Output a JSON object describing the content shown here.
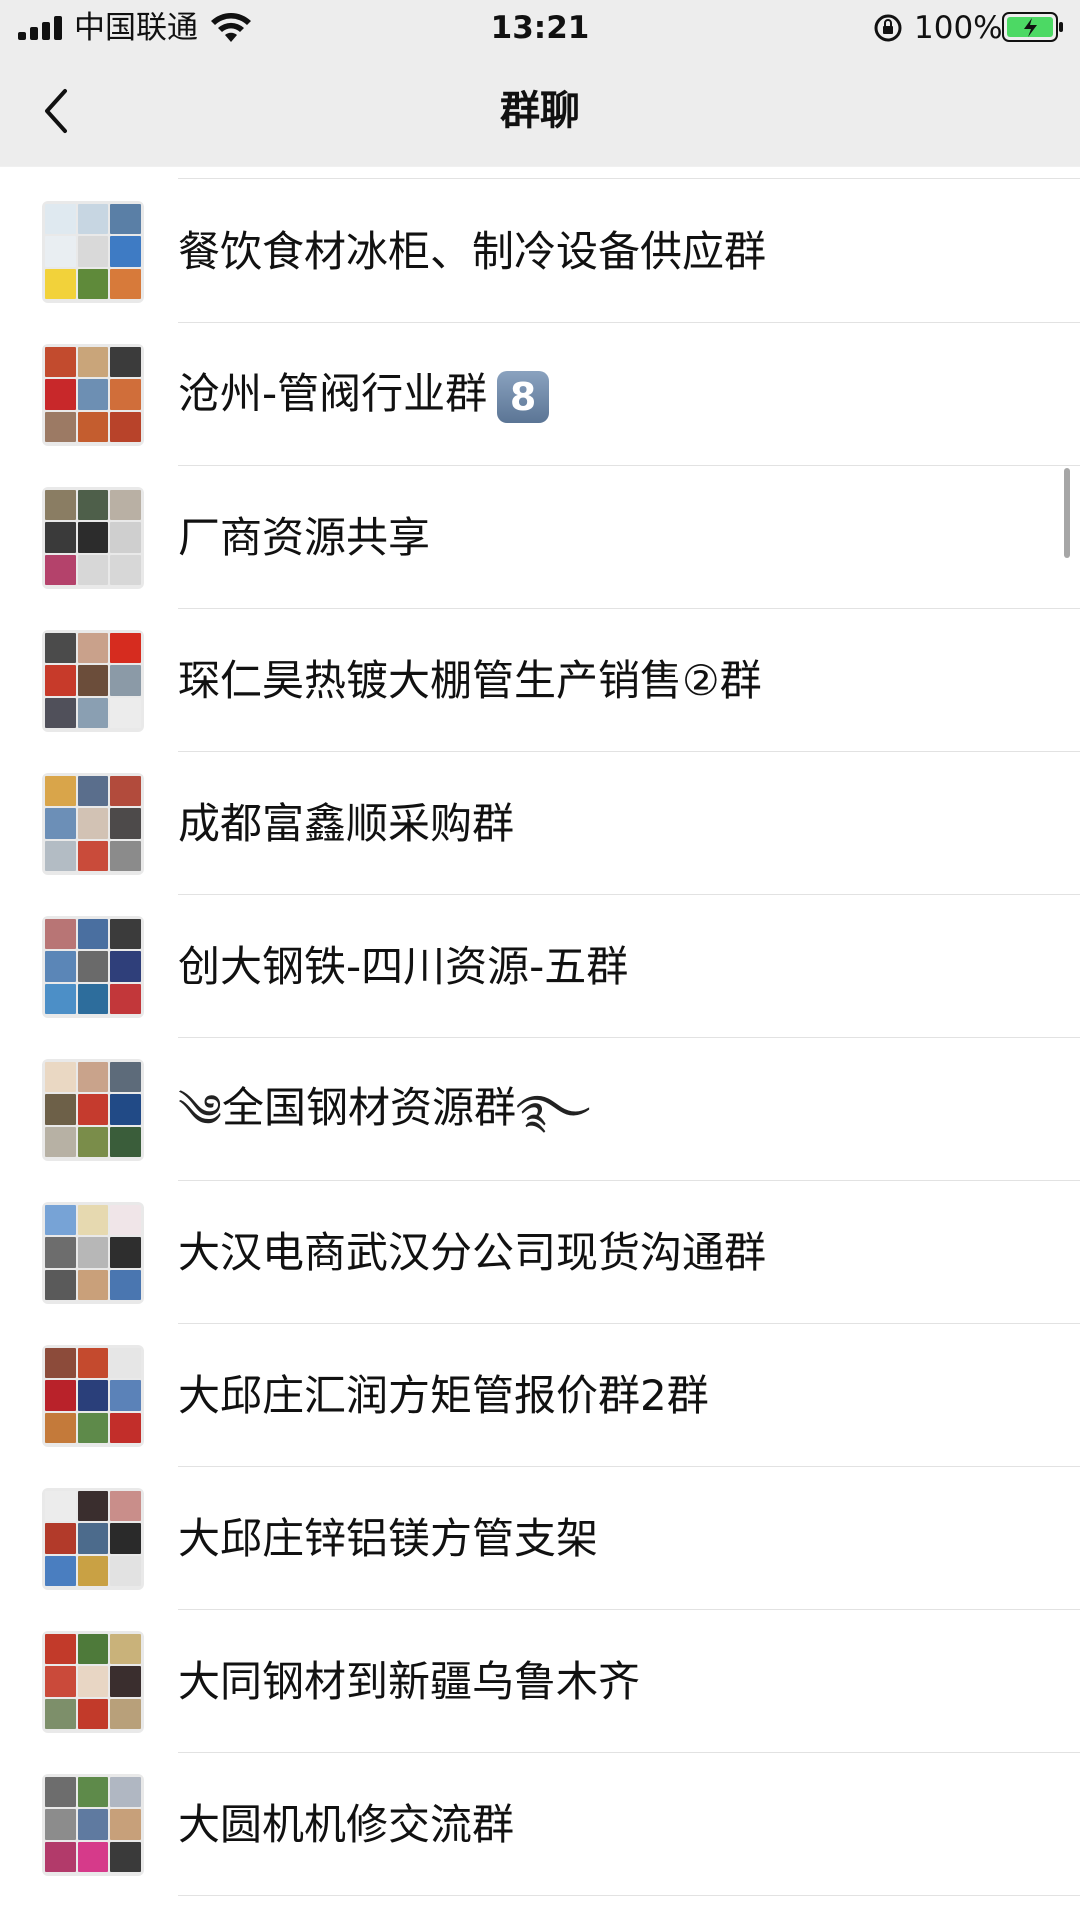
{
  "status_bar": {
    "carrier": "中国联通",
    "time": "13:21",
    "battery": "100%"
  },
  "nav": {
    "title": "群聊",
    "back_icon": "chevron-left-icon"
  },
  "groups": [
    {
      "name": "餐饮食材冰柜、制冷设备供应群"
    },
    {
      "name": "沧州-管阀行业群",
      "badge": "8"
    },
    {
      "name": "厂商资源共享"
    },
    {
      "name": "琛仁昊热镀大棚管生产销售②群"
    },
    {
      "name": "成都富鑫顺采购群"
    },
    {
      "name": "创大钢铁-四川资源-五群"
    },
    {
      "name": "全国钢材资源群",
      "decor": "swirl"
    },
    {
      "name": "大汉电商武汉分公司现货沟通群"
    },
    {
      "name": "大邱庄汇润方矩管报价群2群"
    },
    {
      "name": "大邱庄锌铝镁方管支架"
    },
    {
      "name": "大同钢材到新疆乌鲁木齐"
    },
    {
      "name": "大圆机机修交流群"
    }
  ],
  "colors": {
    "header_bg": "#ededed",
    "divider": "#e2e2e2",
    "badge": "#6b85a5",
    "battery_green": "#4cd964"
  }
}
